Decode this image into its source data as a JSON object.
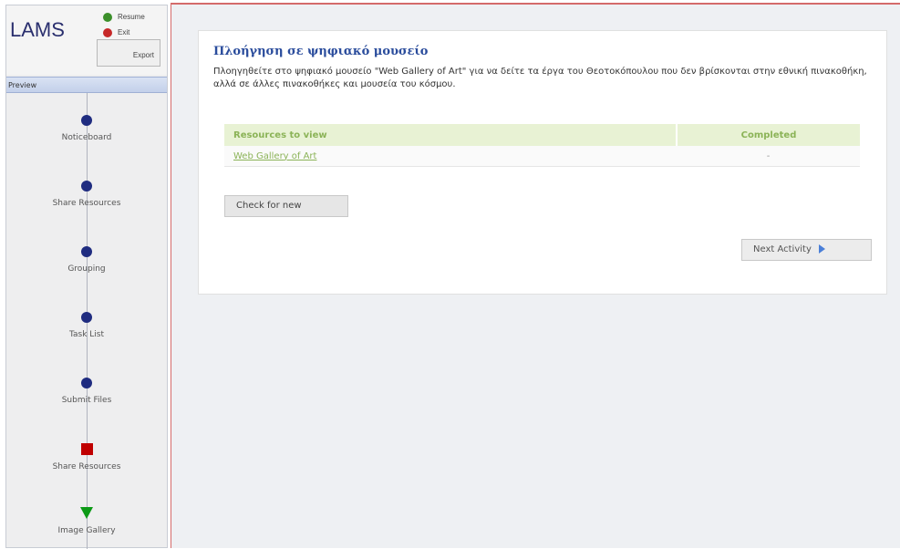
{
  "sidebar": {
    "logo": "LAMS",
    "resume_label": "Resume",
    "exit_label": "Exit",
    "export_label": "Export",
    "preview_label": "Preview",
    "activities": [
      {
        "label": "Noticeboard",
        "marker": "circle"
      },
      {
        "label": "Share Resources",
        "marker": "circle"
      },
      {
        "label": "Grouping",
        "marker": "circle"
      },
      {
        "label": "Task List",
        "marker": "circle"
      },
      {
        "label": "Submit Files",
        "marker": "circle"
      },
      {
        "label": "Share Resources",
        "marker": "square"
      },
      {
        "label": "Image Gallery",
        "marker": "triangle"
      }
    ]
  },
  "main": {
    "title": "Πλοήγηση σε ψηφιακό μουσείο",
    "description": "Πλοηγηθείτε στο ψηφιακό μουσείο \"Web Gallery of Art\" για να δείτε τα έργα του Θεοτοκόπουλου που δεν βρίσκονται στην εθνική πινακοθήκη, αλλά σε άλλες πινακοθήκες και μουσεία του κόσμου.",
    "table": {
      "headers": [
        "Resources to view",
        "Completed"
      ],
      "rows": [
        {
          "resource": "Web Gallery of Art",
          "completed": "-"
        }
      ]
    },
    "check_button": "Check for new",
    "next_button": "Next Activity"
  },
  "colors": {
    "circle_marker": "#1f2c80",
    "current_marker": "#c00000",
    "next_marker": "#0c9a16",
    "title_blue": "#2a4c9c",
    "table_green": "#8bb357"
  }
}
